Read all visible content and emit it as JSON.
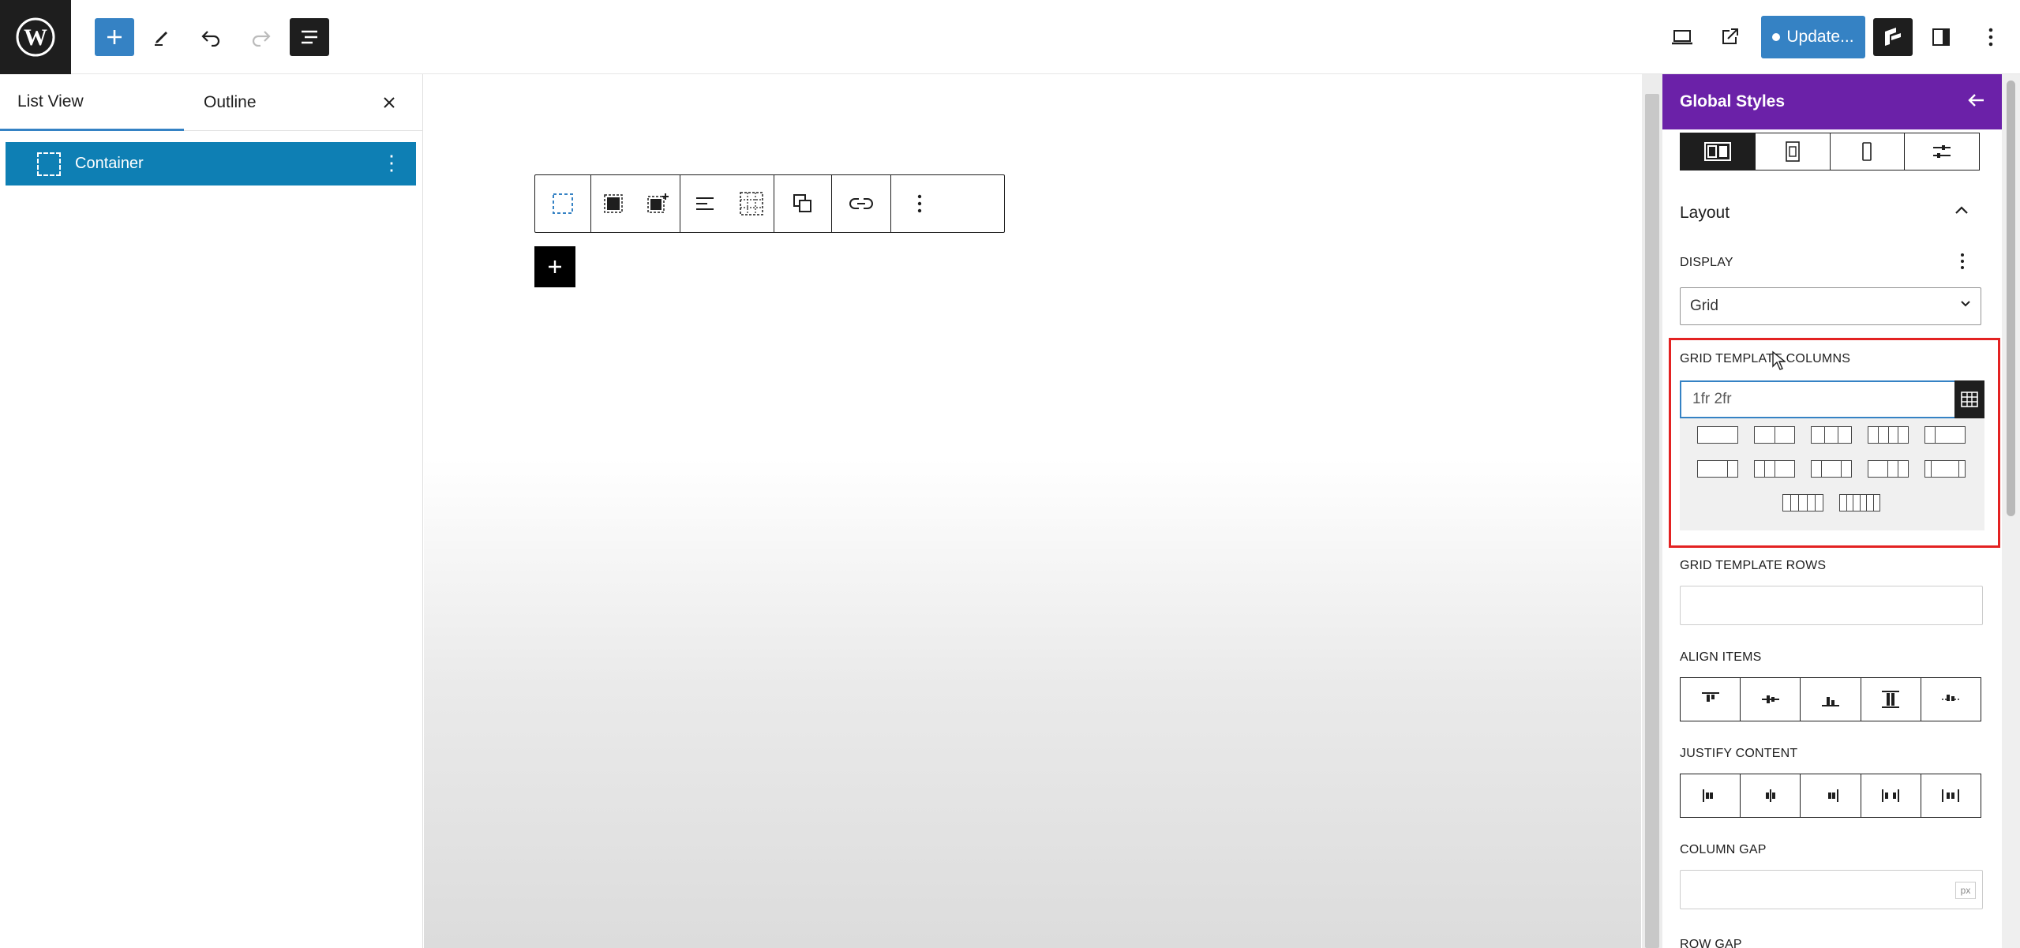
{
  "topbar": {
    "update_label": "Update..."
  },
  "left_panel": {
    "tabs": [
      {
        "label": "List View",
        "active": true
      },
      {
        "label": "Outline",
        "active": false
      }
    ],
    "items": [
      {
        "label": "Container",
        "selected": true
      }
    ]
  },
  "right_panel": {
    "title": "Global Styles",
    "section_title": "Layout",
    "display": {
      "label": "DISPLAY",
      "value": "Grid"
    },
    "grid_template_columns": {
      "label": "GRID TEMPLATE COLUMNS",
      "value": "1fr 2fr"
    },
    "grid_template_rows": {
      "label": "GRID TEMPLATE ROWS",
      "value": ""
    },
    "align_items": {
      "label": "ALIGN ITEMS"
    },
    "justify_content": {
      "label": "JUSTIFY CONTENT"
    },
    "column_gap": {
      "label": "COLUMN GAP",
      "unit": "px"
    },
    "row_gap": {
      "label": "ROW GAP"
    }
  },
  "colors": {
    "accent": "#3582c4",
    "selected_row": "#0e7fb4",
    "panel_header": "#6b21a8",
    "highlight_border": "#e32222"
  }
}
